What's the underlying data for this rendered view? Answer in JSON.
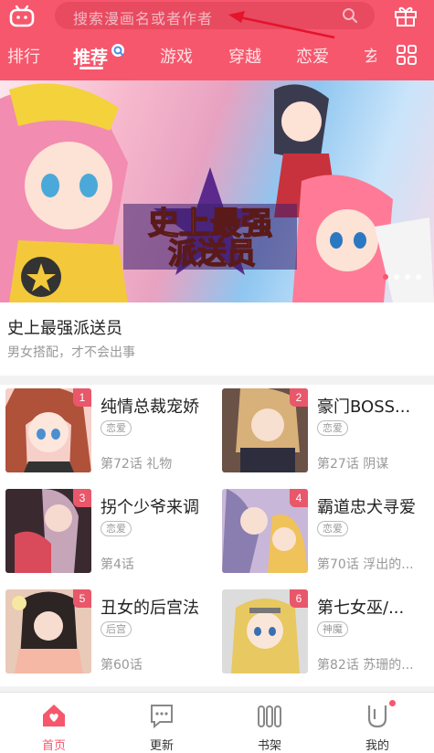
{
  "header": {
    "search_placeholder": "搜索漫画名或者作者",
    "icons": [
      "game-icon",
      "search-icon",
      "gift-icon",
      "grid-icon"
    ],
    "accent_color": "#f6576c"
  },
  "tabs": [
    {
      "label": "排行",
      "active": false
    },
    {
      "label": "推荐",
      "active": true
    },
    {
      "label": "游戏",
      "active": false
    },
    {
      "label": "穿越",
      "active": false
    },
    {
      "label": "恋爱",
      "active": false
    },
    {
      "label": "玄",
      "active": false
    }
  ],
  "banner": {
    "logo_line1": "史上最强",
    "logo_line2": "派送员",
    "title": "史上最强派送员",
    "subtitle": "男女搭配，才不会出事",
    "page_count": 4,
    "active_page": 1
  },
  "comics": [
    {
      "rank": "1",
      "title": "纯情总裁宠娇",
      "tag": "恋爱",
      "episode": "第72话 礼物"
    },
    {
      "rank": "2",
      "title": "豪门BOSS...",
      "tag": "恋爱",
      "episode": "第27话 阴谋"
    },
    {
      "rank": "3",
      "title": "拐个少爷来调",
      "tag": "恋爱",
      "episode": "第4话"
    },
    {
      "rank": "4",
      "title": "霸道忠犬寻爱",
      "tag": "恋爱",
      "episode": "第70话 浮出的..."
    },
    {
      "rank": "5",
      "title": "丑女的后宫法",
      "tag": "后宫",
      "episode": "第60话"
    },
    {
      "rank": "6",
      "title": "第七女巫/...",
      "tag": "神魔",
      "episode": "第82话 苏珊的..."
    }
  ],
  "bottom_nav": [
    {
      "label": "首页",
      "icon": "home-icon",
      "active": true
    },
    {
      "label": "更新",
      "icon": "update-icon",
      "active": false
    },
    {
      "label": "书架",
      "icon": "bookshelf-icon",
      "active": false
    },
    {
      "label": "我的",
      "icon": "profile-icon",
      "active": false
    }
  ]
}
